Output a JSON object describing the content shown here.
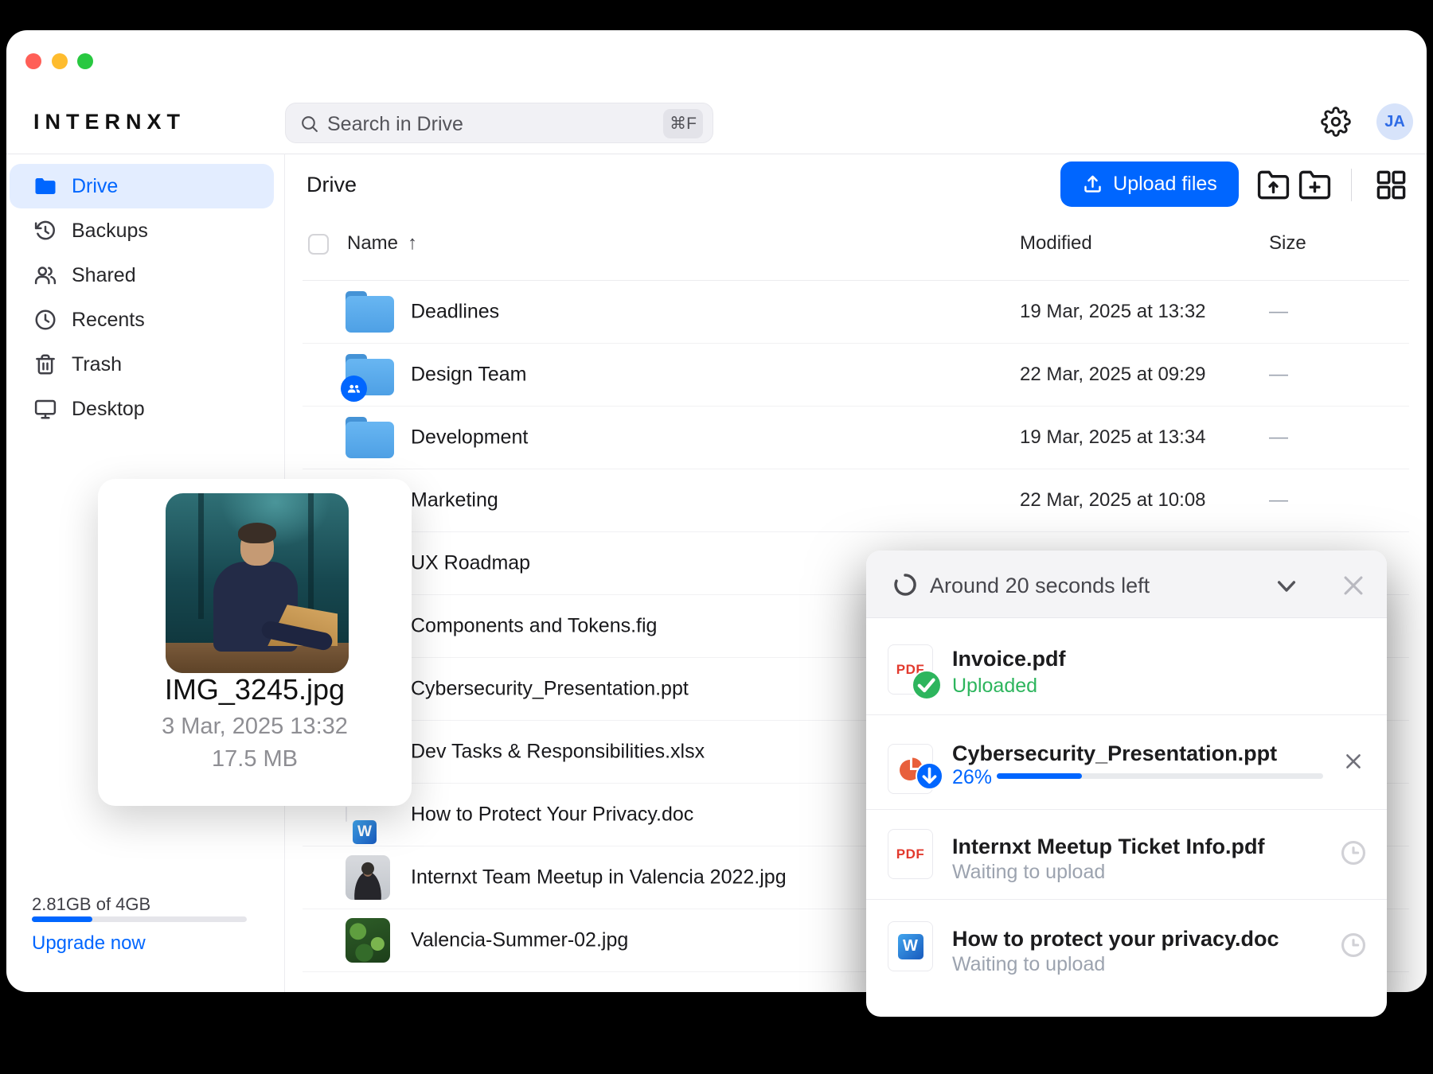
{
  "window": {
    "traffic_lights": [
      "#FF5F57",
      "#FEBC2E",
      "#28C840"
    ]
  },
  "topbar": {
    "logo": "INTERNXT",
    "search": {
      "placeholder": "Search in Drive",
      "shortcut": "⌘F"
    },
    "avatar_initials": "JA"
  },
  "sidebar": {
    "items": [
      {
        "label": "Drive",
        "icon": "folder-filled",
        "active": true
      },
      {
        "label": "Backups",
        "icon": "history",
        "active": false
      },
      {
        "label": "Shared",
        "icon": "people",
        "active": false
      },
      {
        "label": "Recents",
        "icon": "clock",
        "active": false
      },
      {
        "label": "Trash",
        "icon": "trash",
        "active": false
      },
      {
        "label": "Desktop",
        "icon": "desktop",
        "active": false
      }
    ],
    "storage": {
      "usage_label": "2.81GB of 4GB",
      "used_percent": 28,
      "upgrade_label": "Upgrade now"
    }
  },
  "main": {
    "title": "Drive",
    "upload_button_label": "Upload files",
    "columns": {
      "name": "Name",
      "sort_arrow": "↑",
      "modified": "Modified",
      "size": "Size"
    },
    "rows": [
      {
        "name": "Deadlines",
        "icon": "folder",
        "modified": "19 Mar, 2025 at 13:32",
        "size": "—"
      },
      {
        "name": "Design Team",
        "icon": "folder-shared",
        "modified": "22 Mar, 2025 at 09:29",
        "size": "—"
      },
      {
        "name": "Development",
        "icon": "folder",
        "modified": "19 Mar, 2025 at 13:34",
        "size": "—"
      },
      {
        "name": "Marketing",
        "icon": "folder",
        "modified": "22 Mar, 2025 at 10:08",
        "size": "—"
      },
      {
        "name": "UX Roadmap",
        "icon": "folder",
        "modified": "",
        "size": ""
      },
      {
        "name": "Components and Tokens.fig",
        "icon": "generic",
        "modified": "",
        "size": ""
      },
      {
        "name": "Cybersecurity_Presentation.ppt",
        "icon": "generic",
        "modified": "",
        "size": ""
      },
      {
        "name": "Dev Tasks & Responsibilities.xlsx",
        "icon": "generic",
        "modified": "",
        "size": ""
      },
      {
        "name": "How to Protect Your Privacy.doc",
        "icon": "word",
        "modified": "",
        "size": ""
      },
      {
        "name": "Internxt Team Meetup in Valencia 2022.jpg",
        "icon": "photo-portrait",
        "modified": "",
        "size": ""
      },
      {
        "name": "Valencia-Summer-02.jpg",
        "icon": "photo-green",
        "modified": "",
        "size": ""
      }
    ]
  },
  "preview_card": {
    "filename": "IMG_3245.jpg",
    "date": "3 Mar, 2025 13:32",
    "size": "17.5 MB"
  },
  "upload_panel": {
    "status": "Around 20 seconds left",
    "items": [
      {
        "name": "Invoice.pdf",
        "icon": "pdf",
        "status": "Uploaded",
        "status_type": "done"
      },
      {
        "name": "Cybersecurity_Presentation.ppt",
        "icon": "ppt",
        "status": "26%",
        "status_type": "progress",
        "progress_percent": 26
      },
      {
        "name": "Internxt Meetup Ticket Info.pdf",
        "icon": "pdf",
        "status": "Waiting to upload",
        "status_type": "waiting"
      },
      {
        "name": "How to protect your privacy.doc",
        "icon": "word",
        "status": "Waiting to upload",
        "status_type": "waiting"
      }
    ]
  },
  "colors": {
    "accent": "#0066FF",
    "success": "#2DB55D",
    "pdf_red": "#E23A2E",
    "ppt_orange": "#E8603C",
    "word_blue": "#185ABD"
  }
}
